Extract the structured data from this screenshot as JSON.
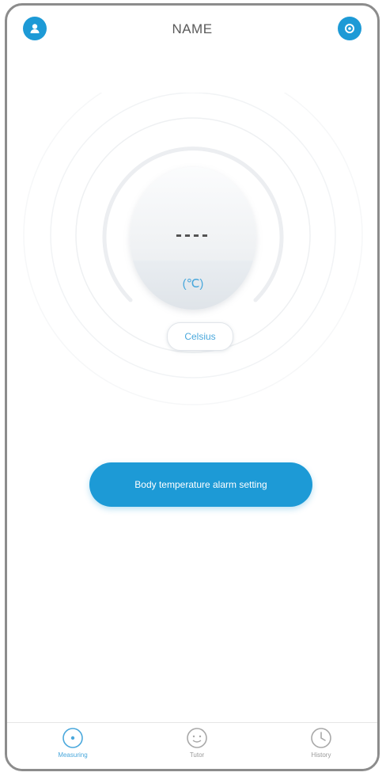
{
  "header": {
    "title": "NAME",
    "left_icon": "user-icon",
    "right_icon": "settings-icon",
    "accent_color": "#1d9ad6"
  },
  "thermometer": {
    "reading": "----",
    "unit_symbol": "(℃)",
    "unit_button_label": "Celsius"
  },
  "alarm_button": {
    "label": "Body temperature alarm setting"
  },
  "tabs": [
    {
      "label": "Measuring",
      "icon": "measure-icon",
      "active": true
    },
    {
      "label": "Tutor",
      "icon": "face-icon",
      "active": false
    },
    {
      "label": "History",
      "icon": "clock-icon",
      "active": false
    }
  ]
}
